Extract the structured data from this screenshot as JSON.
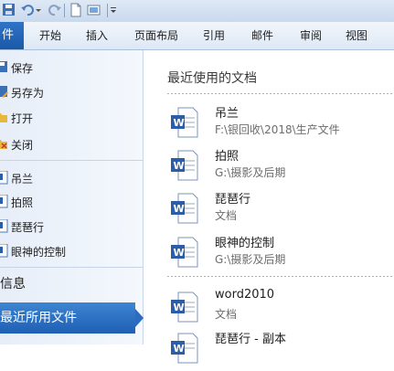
{
  "tabs": {
    "file": "件",
    "items": [
      "开始",
      "插入",
      "页面布局",
      "引用",
      "邮件",
      "审阅",
      "视图"
    ]
  },
  "nav": {
    "items": [
      {
        "label": "保存",
        "icon": "save-icon"
      },
      {
        "label": "另存为",
        "icon": "save-as-icon"
      },
      {
        "label": "打开",
        "icon": "open-folder-icon"
      },
      {
        "label": "关闭",
        "icon": "close-doc-icon"
      }
    ],
    "recent_docs": [
      {
        "label": "吊兰",
        "icon": "word-doc-icon"
      },
      {
        "label": "拍照",
        "icon": "word-doc-icon"
      },
      {
        "label": "琵琶行",
        "icon": "word-doc-icon"
      },
      {
        "label": "眼神的控制",
        "icon": "word-doc-icon"
      }
    ],
    "info": "信息",
    "recent": "最近所用文件"
  },
  "main": {
    "heading": "最近使用的文档",
    "docs": [
      {
        "name": "吊兰",
        "path": "F:\\银回收\\2018\\生产文件"
      },
      {
        "name": "拍照",
        "path": "G:\\摄影及后期"
      },
      {
        "name": "琵琶行",
        "path": "文档"
      },
      {
        "name": "眼神的控制",
        "path": "G:\\摄影及后期"
      },
      {
        "name": "word2010",
        "path": "文档"
      },
      {
        "name": "琵琶行 - 副本",
        "path": ""
      }
    ]
  },
  "colors": {
    "accent": "#1f5fb4",
    "ribbon": "#dde8f5"
  }
}
